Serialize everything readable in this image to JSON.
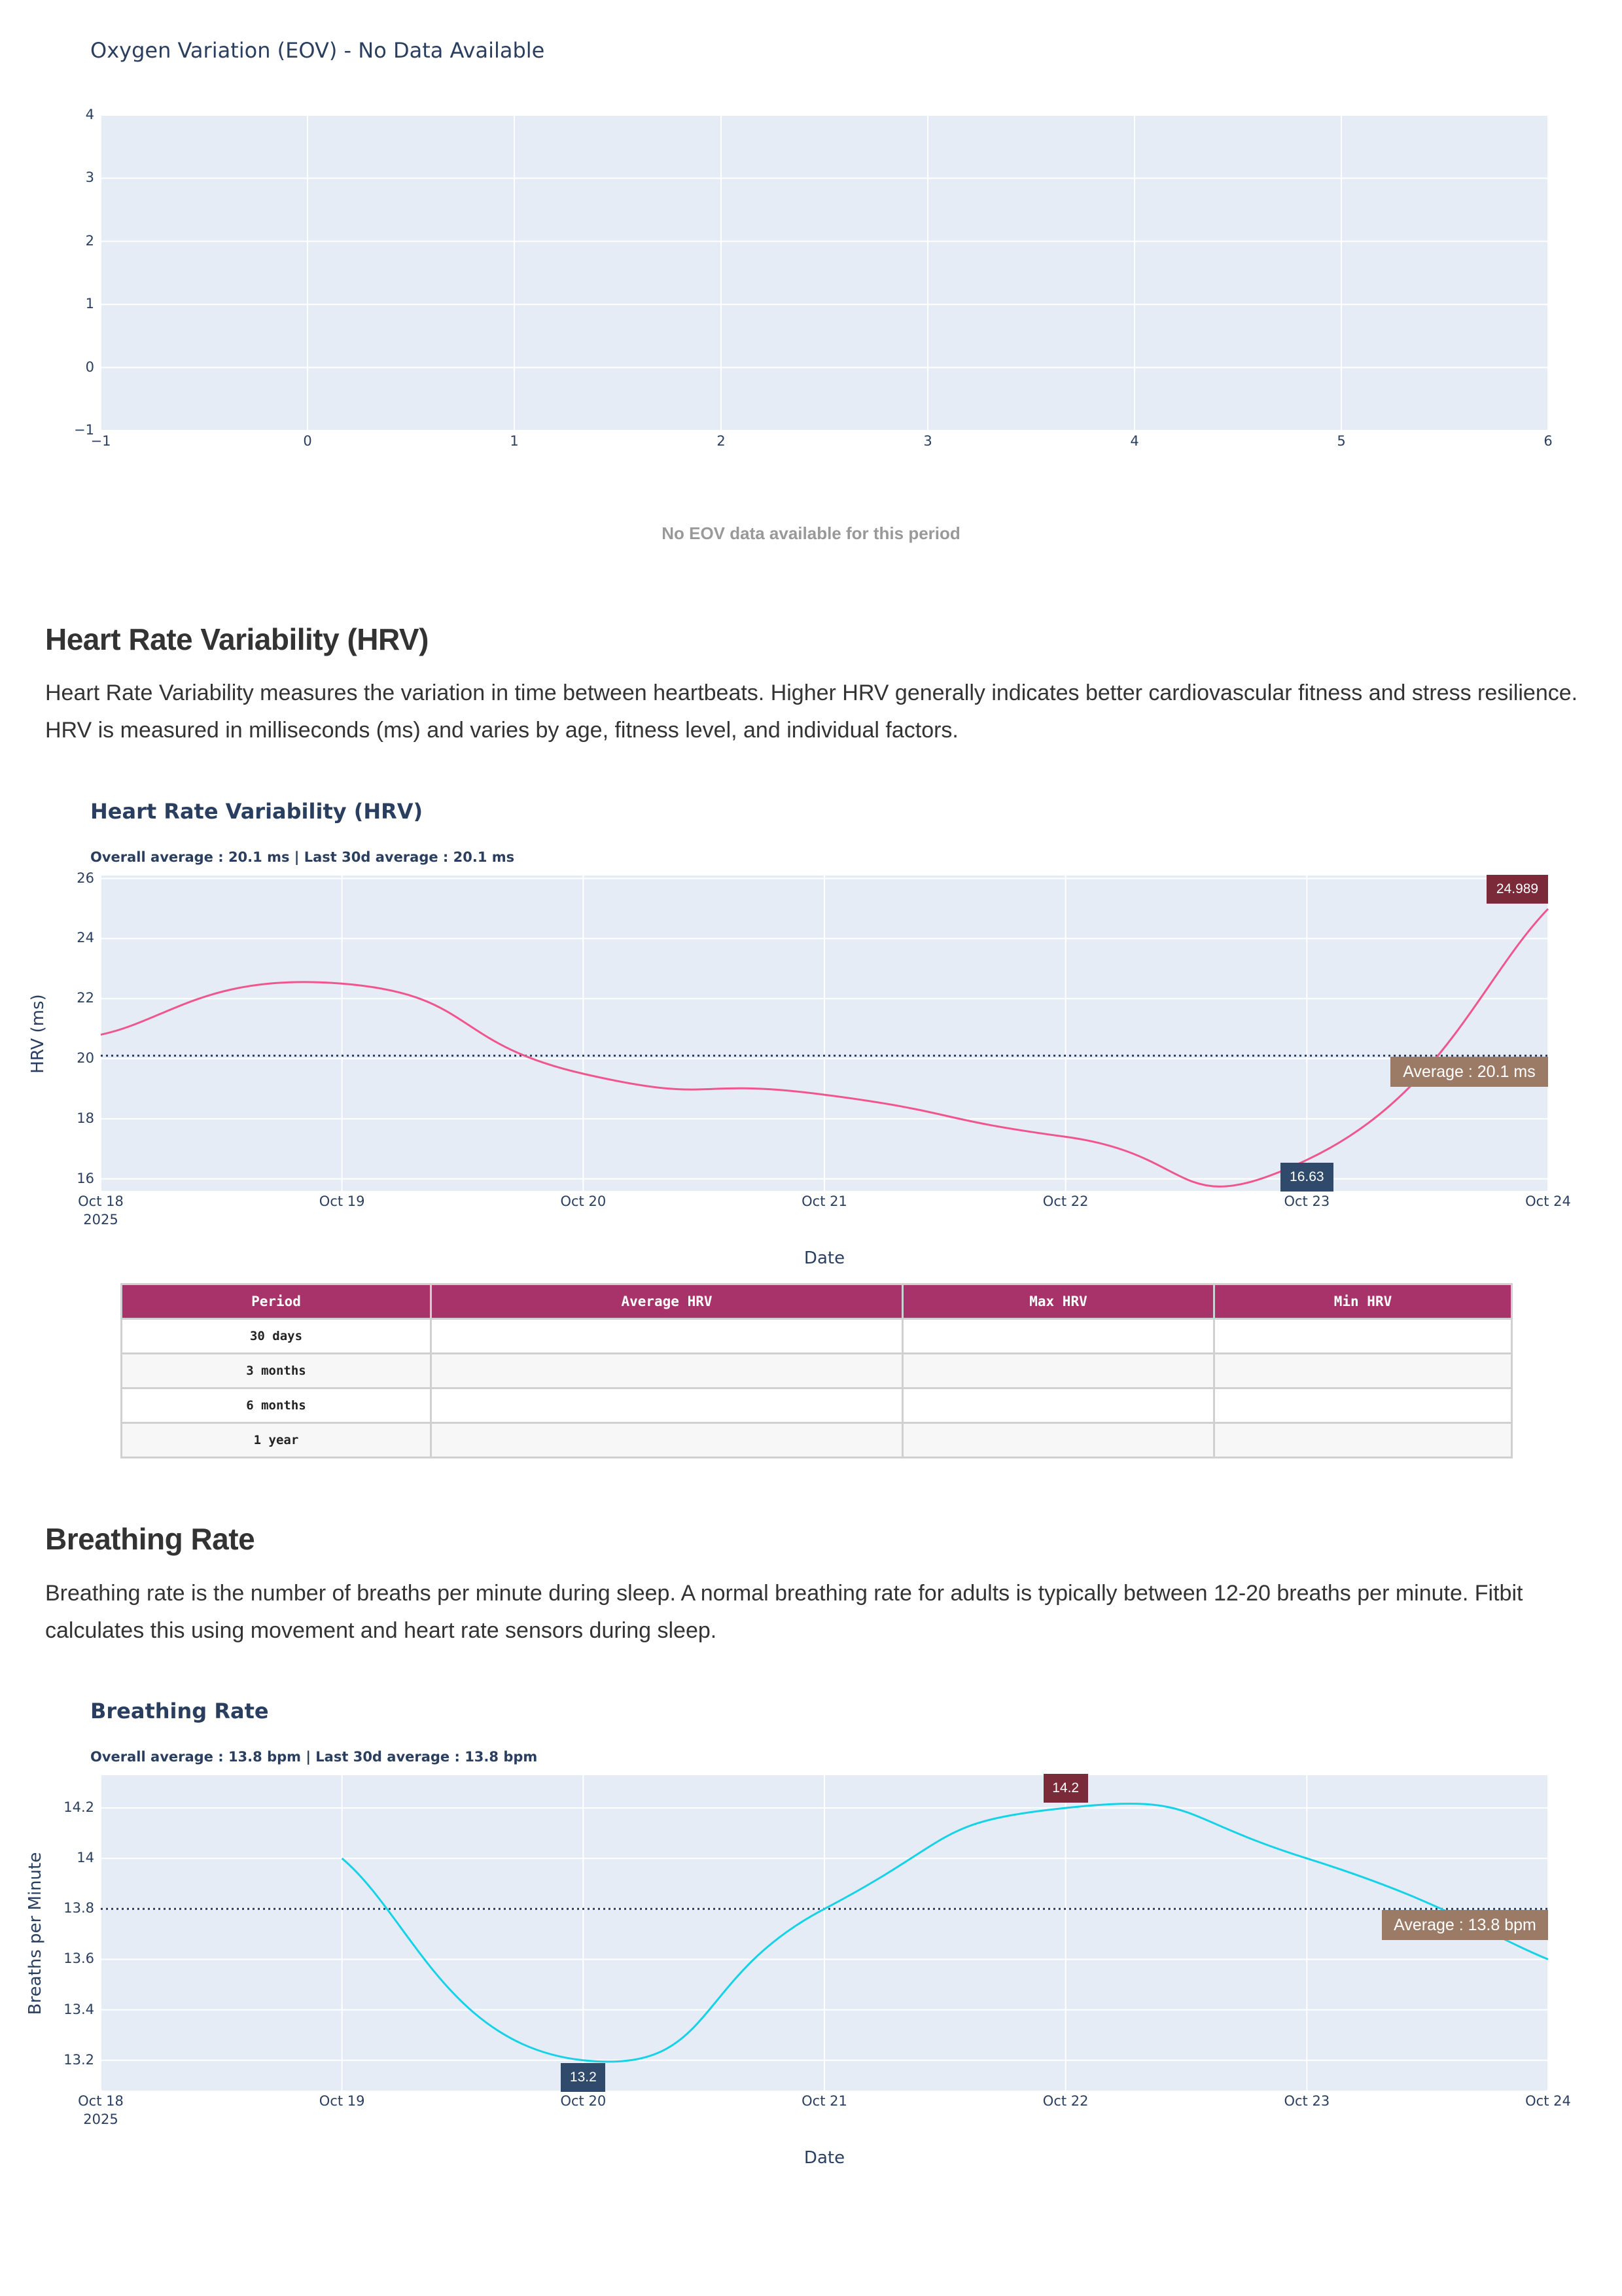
{
  "eov": {
    "title": "Oxygen Variation (EOV) - No Data Available",
    "no_data_text": "No EOV data available for this period",
    "chart_data": {
      "type": "scatter",
      "x": [],
      "y": [],
      "xlim": [
        -1,
        6
      ],
      "ylim": [
        -1,
        4
      ],
      "x_ticks": [
        "−1",
        "0",
        "1",
        "2",
        "3",
        "4",
        "5",
        "6"
      ],
      "y_ticks": [
        "4",
        "3",
        "2",
        "1",
        "0",
        "−1"
      ],
      "grid": true
    }
  },
  "hrv_section": {
    "heading": "Heart Rate Variability (HRV)",
    "description": "Heart Rate Variability measures the variation in time between heartbeats. Higher HRV generally indicates better cardiovascular fitness and stress resilience. HRV is measured in milliseconds (ms) and varies by age, fitness level, and individual factors."
  },
  "hrv_chart": {
    "title": "Heart Rate Variability (HRV)",
    "subtitle": "Overall average : 20.1 ms | Last 30d average : 20.1 ms",
    "chart_data": {
      "type": "line",
      "x": [
        "2025-10-18",
        "2025-10-19",
        "2025-10-20",
        "2025-10-21",
        "2025-10-22",
        "2025-10-23",
        "2025-10-24"
      ],
      "y": [
        20.8,
        22.5,
        19.5,
        18.8,
        17.4,
        16.63,
        24.989
      ],
      "x_tick_labels": [
        "Oct 18",
        "Oct 19",
        "Oct 20",
        "Oct 21",
        "Oct 22",
        "Oct 23",
        "Oct 24"
      ],
      "x_tick_sublabel": "2025",
      "y_ticks": [
        16,
        18,
        20,
        22,
        24,
        26
      ],
      "ylim": [
        15.6,
        26.1
      ],
      "xlabel": "Date",
      "ylabel": "HRV (ms)",
      "average": 20.1,
      "average_label": "Average : 20.1 ms",
      "max_label": "24.989",
      "min_label": "16.63",
      "line_color": "#f0568e",
      "max_color": "#7b2a3a",
      "min_color": "#2f4a6b",
      "avg_color": "#9b7b65",
      "grid": true
    }
  },
  "hrv_table": {
    "headers": [
      "Period",
      "Average HRV",
      "Max HRV",
      "Min HRV"
    ],
    "rows": [
      [
        "30 days",
        "",
        "",
        ""
      ],
      [
        "3 months",
        "",
        "",
        ""
      ],
      [
        "6 months",
        "",
        "",
        ""
      ],
      [
        "1 year",
        "",
        "",
        ""
      ]
    ],
    "header_color": "#a8336b"
  },
  "br_section": {
    "heading": "Breathing Rate",
    "description": "Breathing rate is the number of breaths per minute during sleep. A normal breathing rate for adults is typically between 12-20 breaths per minute. Fitbit calculates this using movement and heart rate sensors during sleep."
  },
  "br_chart": {
    "title": "Breathing Rate",
    "subtitle": "Overall average : 13.8 bpm | Last 30d average : 13.8 bpm",
    "chart_data": {
      "type": "line",
      "x": [
        "2025-10-19",
        "2025-10-20",
        "2025-10-21",
        "2025-10-22",
        "2025-10-23",
        "2025-10-24"
      ],
      "y": [
        14.0,
        13.2,
        13.8,
        14.2,
        14.0,
        13.6
      ],
      "x_tick_labels": [
        "Oct 18",
        "Oct 19",
        "Oct 20",
        "Oct 21",
        "Oct 22",
        "Oct 23",
        "Oct 24"
      ],
      "x_tick_sublabel": "2025",
      "y_ticks": [
        13.2,
        13.4,
        13.6,
        13.8,
        14,
        14.2
      ],
      "y_tick_labels": [
        "13.2",
        "13.4",
        "13.6",
        "13.8",
        "14",
        "14.2"
      ],
      "ylim": [
        13.08,
        14.33
      ],
      "xlabel": "Date",
      "ylabel": "Breaths per Minute",
      "average": 13.8,
      "average_label": "Average : 13.8 bpm",
      "max_label": "14.2",
      "min_label": "13.2",
      "line_color": "#17d2e6",
      "max_color": "#7b2a3a",
      "min_color": "#2f4a6b",
      "avg_color": "#9b7b65",
      "grid": true
    }
  }
}
